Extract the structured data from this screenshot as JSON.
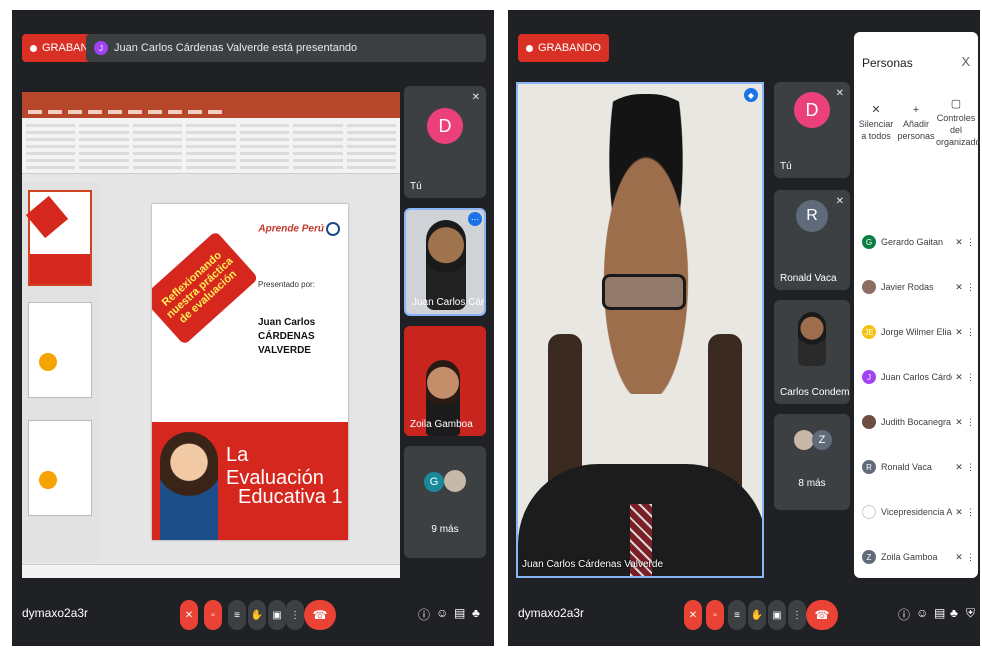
{
  "left": {
    "recording_label": "GRABANDO",
    "presenter_banner": "Juan Carlos Cárdenas Valverde está presentando",
    "presenter_initial": "J",
    "slide": {
      "banner_text": "Reflexionando nuestra práctica de evaluación",
      "logo_text": "Aprende Perú",
      "presented_by": "Presentado por:",
      "presenter_name_line1": "Juan Carlos",
      "presenter_name_line2": "CÁRDENAS VALVERDE",
      "subtitle_line1": "La Evaluación",
      "subtitle_line2": "Educativa 1"
    },
    "tiles": {
      "you_initial": "D",
      "you_label": "Tú",
      "presenter_label": "Juan Carlos Cárdena...",
      "zoila_label": "Zoila Gamboa",
      "more_initial": "G",
      "more_label": "9 más"
    },
    "meeting_code": "dymaxo2a3r"
  },
  "right": {
    "recording_label": "GRABANDO",
    "main_video_label": "Juan Carlos Cárdenas Valverde",
    "tiles": {
      "you_initial": "D",
      "you_label": "Tú",
      "ronald_initial": "R",
      "ronald_label": "Ronald Vaca",
      "carlos_label": "Carlos Condemarin",
      "more_initial": "Z",
      "more_label": "8 más"
    },
    "meeting_code": "dymaxo2a3r",
    "people_panel": {
      "title": "Personas",
      "close": "X",
      "actions": [
        {
          "label": "Silenciar a todos",
          "icon": "mute-all-icon"
        },
        {
          "label": "Añadir personas",
          "icon": "add-person-icon"
        },
        {
          "label": "Controles del organizador",
          "icon": "host-controls-icon"
        }
      ],
      "participants": [
        {
          "name": "Gerardo Gaitan",
          "initial": "G",
          "color": "#0b8043"
        },
        {
          "name": "Javier Rodas",
          "initial": "",
          "color": "#8d6e63"
        },
        {
          "name": "Jorge Wilmer Elias S...",
          "initial": "JE",
          "color": "#f4c20d"
        },
        {
          "name": "Juan Carlos Cárden...",
          "initial": "J",
          "color": "#a142f4"
        },
        {
          "name": "Judith Bocanegra",
          "initial": "",
          "color": "#6d4c41"
        },
        {
          "name": "Ronald Vaca",
          "initial": "R",
          "color": "#5f6b7a"
        },
        {
          "name": "Vicepresidencia Aca...",
          "initial": "",
          "color": "#ffffff"
        },
        {
          "name": "Zoila Gamboa",
          "initial": "Z",
          "color": "#5f6b7a"
        }
      ]
    }
  },
  "colors": {
    "meet_bg": "#202124",
    "tile_bg": "#3c4043",
    "recording_red": "#d93025",
    "end_call_red": "#ea4335",
    "accent_blue": "#8ab4f8",
    "avatar_pink": "#ec407a"
  }
}
